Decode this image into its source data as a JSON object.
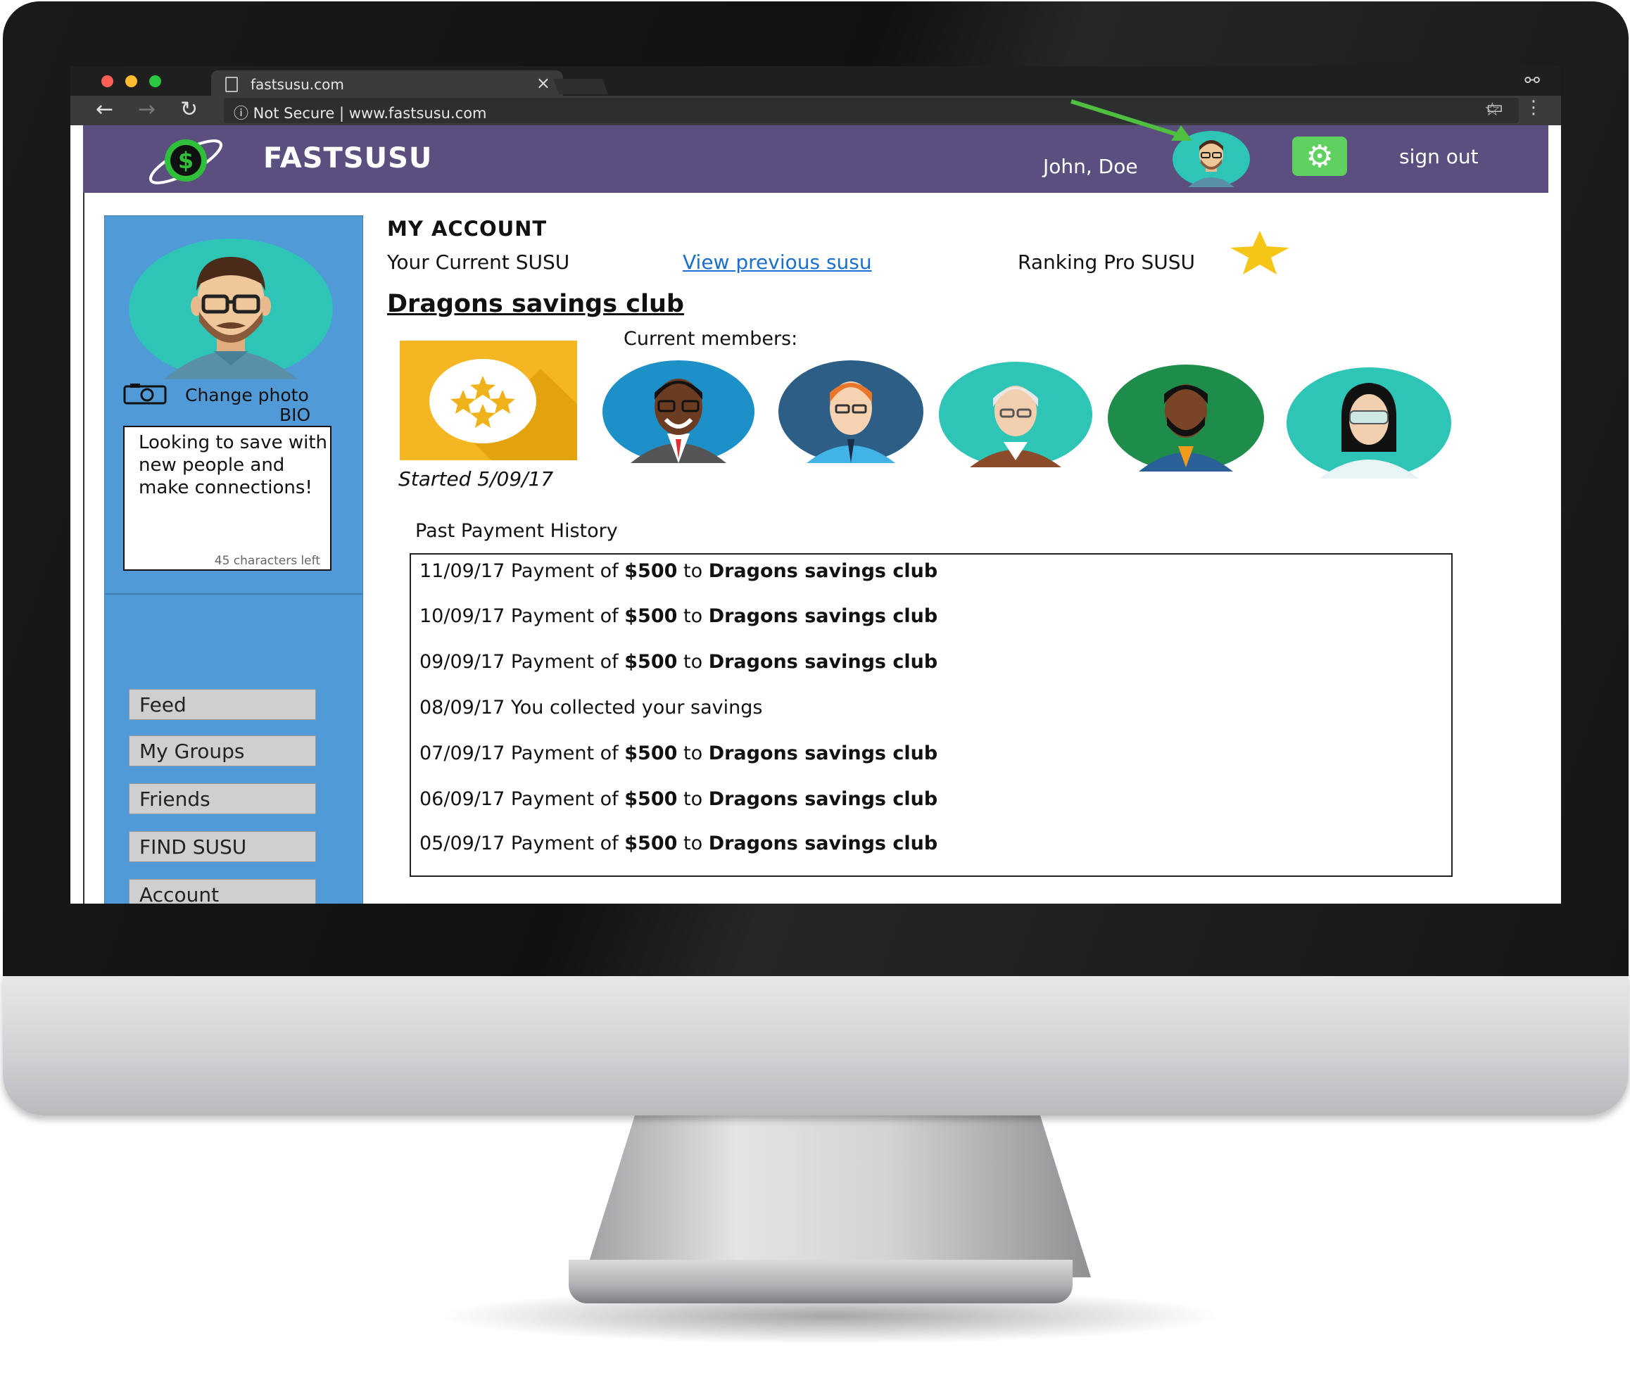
{
  "browser": {
    "tab_title": "fastsusu.com",
    "tab_close": "×",
    "address": "ⓘ Not Secure | www.fastsusu.com",
    "nav_back": "←",
    "nav_forward": "→",
    "nav_reload": "↻",
    "bookmark": "☆",
    "incognito": "⚯",
    "menu": "⋮",
    "cast": "▭",
    "traffic_colors": [
      "#ff5f57",
      "#febc2e",
      "#28c840"
    ]
  },
  "header": {
    "brand": "FASTSUSU",
    "logo_icon": "dollar-globe-icon",
    "user_name": "John, Doe",
    "settings_icon": "⚙",
    "signout": "sign out",
    "bg_color": "#5a4f7f",
    "arrow_color": "#4fbf3f"
  },
  "sidebar": {
    "change_photo": "Change photo",
    "bio_label": "BIO",
    "bio_text": "Looking to save with new people and make connections!",
    "bio_chars_left": "45 characters left",
    "nav": [
      "Feed",
      "My Groups",
      "Friends",
      "FIND SUSU",
      "Account"
    ],
    "bg_color": "#4f9ad7"
  },
  "main": {
    "title": "MY ACCOUNT",
    "current_susu": "Your Current  SUSU",
    "view_previous": "View previous susu",
    "ranking": "Ranking Pro SUSU",
    "club_name": "Dragons savings club",
    "started": "Started 5/09/17",
    "members_label": "Current members:",
    "history_label": "Past Payment History",
    "history": [
      {
        "date": "11/09/17",
        "pre": " Payment of ",
        "amount": "$500",
        "mid": " to ",
        "club": "Dragons savings club"
      },
      {
        "date": "10/09/17",
        "pre": " Payment of ",
        "amount": "$500",
        "mid": " to ",
        "club": "Dragons savings club"
      },
      {
        "date": "09/09/17",
        "pre": " Payment of ",
        "amount": "$500",
        "mid": " to ",
        "club": "Dragons savings club"
      },
      {
        "date": "08/09/17",
        "pre": " You collected your savings",
        "amount": "",
        "mid": "",
        "club": ""
      },
      {
        "date": "07/09/17",
        "pre": " Payment of ",
        "amount": "$500",
        "mid": " to ",
        "club": "Dragons savings club"
      },
      {
        "date": "06/09/17",
        "pre": " Payment of ",
        "amount": "$500",
        "mid": " to ",
        "club": "Dragons savings club"
      },
      {
        "date": "05/09/17",
        "pre": " Payment of ",
        "amount": "$500",
        "mid": " to ",
        "club": "Dragons savings club"
      }
    ]
  }
}
